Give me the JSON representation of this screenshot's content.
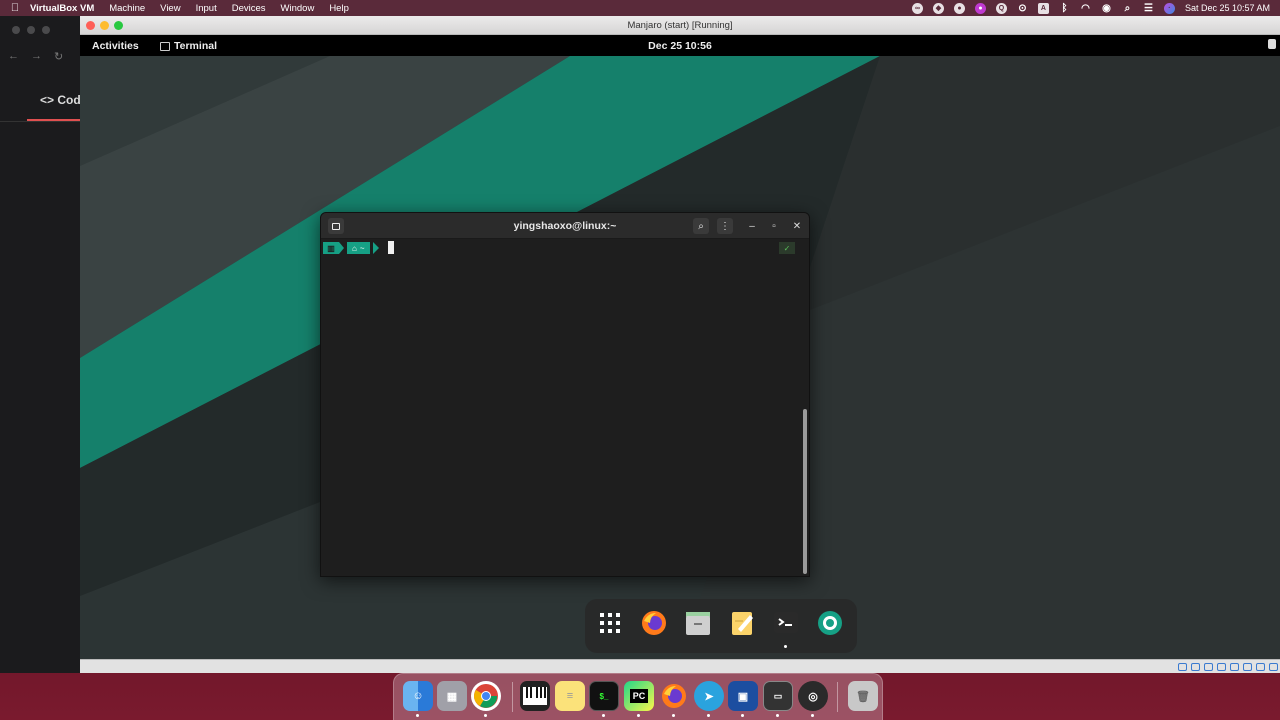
{
  "mac_menubar": {
    "app_name": "VirtualBox VM",
    "menus": [
      "Machine",
      "View",
      "Input",
      "Devices",
      "Window",
      "Help"
    ],
    "status_icons": [
      "creative-cloud-icon",
      "dropbox-icon",
      "app-icon",
      "app-icon",
      "app-icon",
      "record-icon",
      "text-input-icon",
      "bluetooth-icon",
      "wifi-icon",
      "user-icon",
      "search-icon",
      "control-center-icon",
      "siri-icon"
    ],
    "datetime": "Sat Dec 25  10:57 AM"
  },
  "background_browser": {
    "code_tab_label": "<> Cod"
  },
  "vbox_window": {
    "title": "Manjaro (start) [Running]"
  },
  "gnome_topbar": {
    "activities": "Activities",
    "app_name": "Terminal",
    "clock": "Dec 25  10:56"
  },
  "terminal": {
    "title": "yingshaoxo@linux:~",
    "prompt_dir": "~",
    "status_check": "✓"
  },
  "gnome_dash": {
    "apps": [
      "app-grid",
      "firefox",
      "files",
      "text-editor",
      "terminal",
      "screenshot"
    ]
  },
  "mac_dock": {
    "apps": [
      "Finder",
      "Launchpad",
      "Chrome",
      "Piano",
      "Notes",
      "Terminal",
      "PyCharm",
      "Firefox",
      "Telegram",
      "VirtualBox",
      "Screen",
      "OBS",
      "Trash"
    ],
    "pycharm_label": "PC"
  },
  "colors": {
    "manjaro_green": "#16a085",
    "wallpaper_dark": "#2b3232",
    "mac_desktop": "#5a0f22"
  }
}
